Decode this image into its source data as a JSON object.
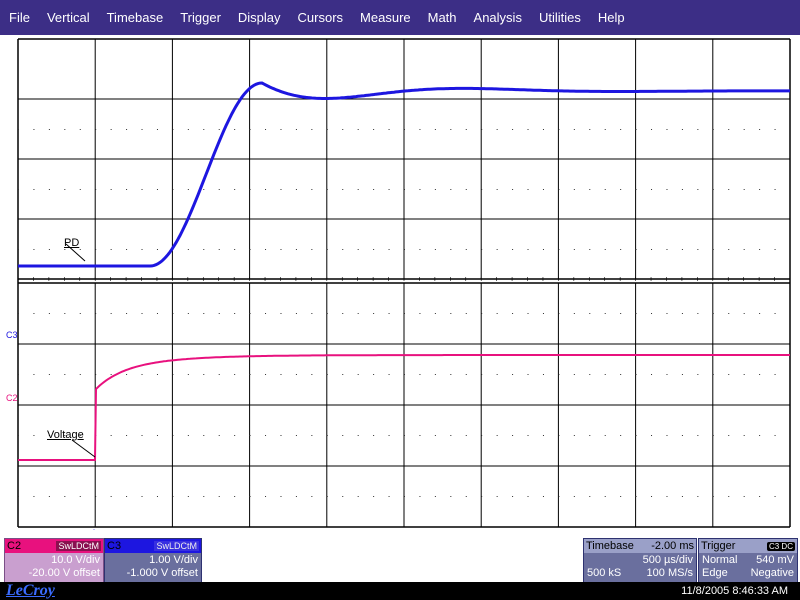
{
  "menu": [
    "File",
    "Vertical",
    "Timebase",
    "Trigger",
    "Display",
    "Cursors",
    "Measure",
    "Math",
    "Analysis",
    "Utilities",
    "Help"
  ],
  "traces": {
    "pd_label": "PD",
    "voltage_label": "Voltage",
    "c3_marker": "C3",
    "c2_marker": "C2",
    "colors": {
      "pd": "#1d16e0",
      "voltage": "#e8117e"
    }
  },
  "c2_panel": {
    "name": "C2",
    "tag": "SwLDCtM",
    "scale": "10.0 V/div",
    "offset": "-20.00 V offset"
  },
  "c3_panel": {
    "name": "C3",
    "tag": "SwLDCtM",
    "scale": "1.00 V/div",
    "offset": "-1.000 V offset"
  },
  "timebase": {
    "title": "Timebase",
    "delay": "-2.00 ms",
    "div": "500 µs/div",
    "samples": "500 kS",
    "rate": "100 MS/s"
  },
  "trigger": {
    "title": "Trigger",
    "source": "C3 DC",
    "mode": "Normal",
    "level": "540 mV",
    "type": "Edge",
    "slope": "Negative"
  },
  "status": {
    "logo": "LeCroy",
    "datetime": "11/8/2005 8:46:33 AM"
  }
}
